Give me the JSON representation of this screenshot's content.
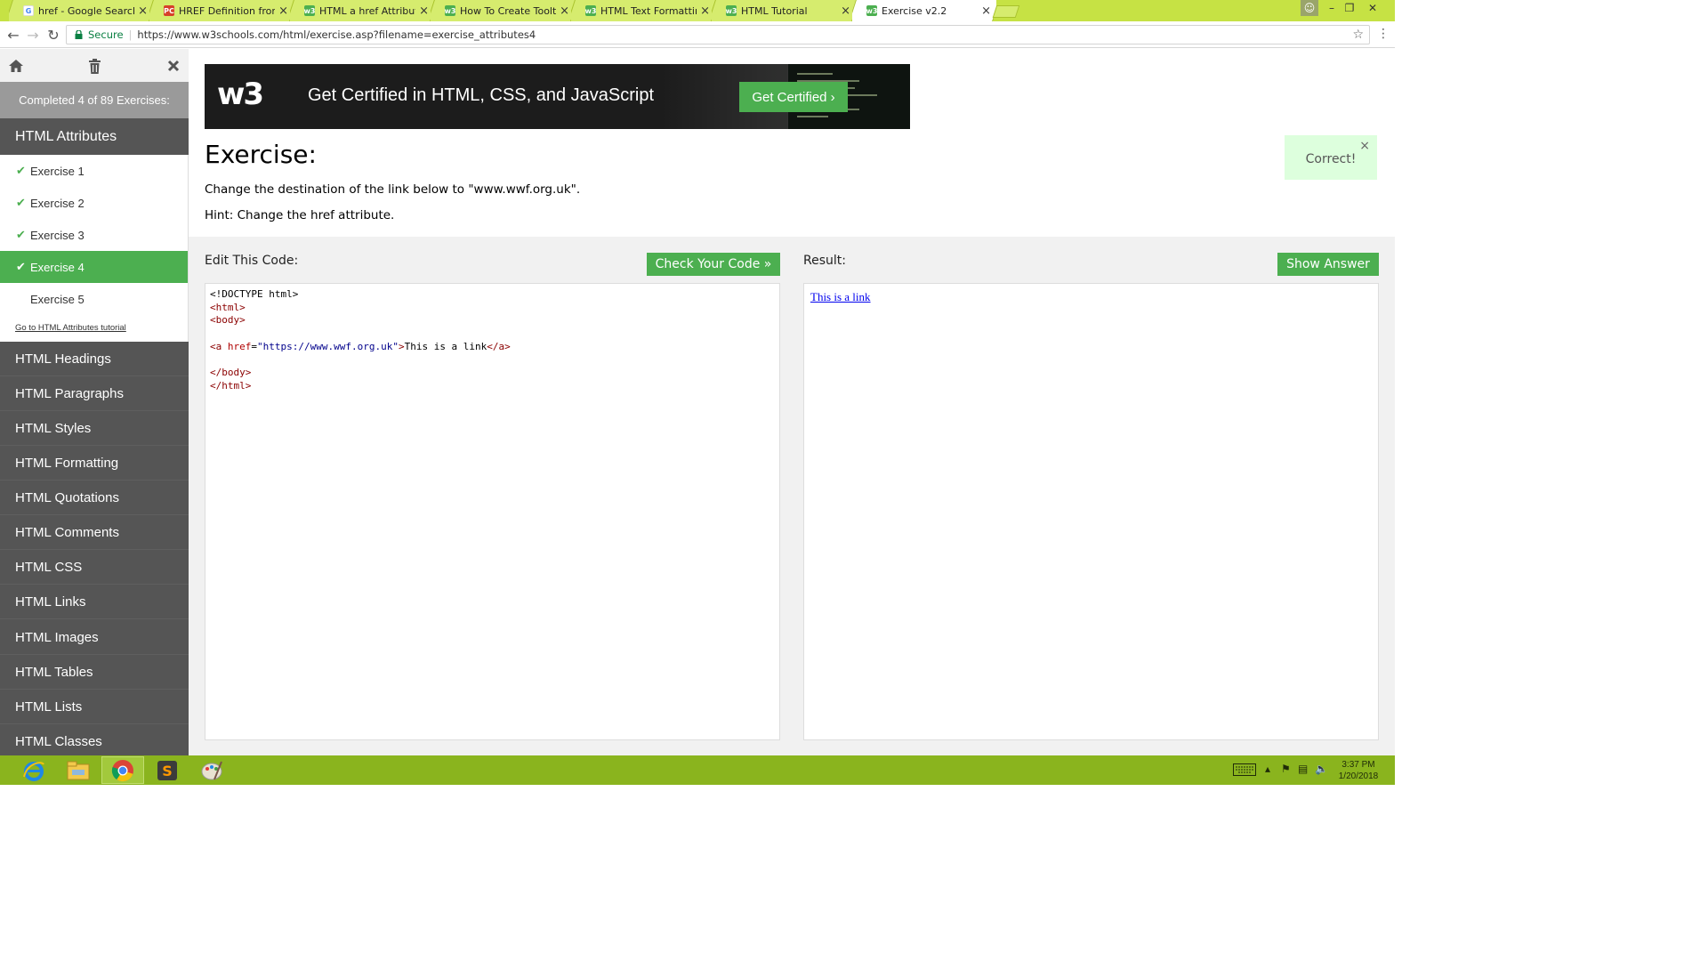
{
  "browser": {
    "tabs": [
      {
        "title": "href - Google Search",
        "favicon": "google-icon"
      },
      {
        "title": "HREF Definition from PC",
        "favicon": "pcmag-icon"
      },
      {
        "title": "HTML a href Attribute",
        "favicon": "w3schools-icon"
      },
      {
        "title": "How To Create Tooltips",
        "favicon": "w3schools-icon"
      },
      {
        "title": "HTML Text Formatting",
        "favicon": "w3schools-icon"
      },
      {
        "title": "HTML Tutorial",
        "favicon": "w3schools-icon"
      },
      {
        "title": "Exercise v2.2",
        "favicon": "w3schools-icon",
        "active": true
      }
    ],
    "secure_label": "Secure",
    "url": "https://www.w3schools.com/html/exercise.asp?filename=exercise_attributes4",
    "accent_color": "#c6e244"
  },
  "sidebar": {
    "completed": "Completed 4 of 89 Exercises:",
    "active_category": "HTML Attributes",
    "exercises": [
      {
        "label": "Exercise 1",
        "done": true
      },
      {
        "label": "Exercise 2",
        "done": true
      },
      {
        "label": "Exercise 3",
        "done": true
      },
      {
        "label": "Exercise 4",
        "done": true,
        "active": true
      },
      {
        "label": "Exercise 5",
        "done": false
      }
    ],
    "tutorial_link": "Go to HTML Attributes tutorial",
    "categories": [
      "HTML Headings",
      "HTML Paragraphs",
      "HTML Styles",
      "HTML Formatting",
      "HTML Quotations",
      "HTML Comments",
      "HTML CSS",
      "HTML Links",
      "HTML Images",
      "HTML Tables",
      "HTML Lists",
      "HTML Classes"
    ]
  },
  "banner": {
    "logo": "w3",
    "text": "Get Certified in HTML, CSS, and JavaScript",
    "button": "Get Certified ›"
  },
  "exercise": {
    "title": "Exercise:",
    "description": "Change the destination of the link below to \"www.wwf.org.uk\".",
    "hint": "Hint: Change the href attribute.",
    "correct_label": "Correct!",
    "close_symbol": "×"
  },
  "editor": {
    "heading": "Edit This Code:",
    "check_button": "Check Your Code »",
    "code": {
      "doctype": "<!DOCTYPE html>",
      "html_open": "<html>",
      "body_open": "<body>",
      "a_open": "<a ",
      "attr_name": "href",
      "attr_eq": "=",
      "attr_value": "\"https://www.wwf.org.uk\"",
      "a_close_bracket": ">",
      "link_text": "This is a link",
      "a_close": "</a>",
      "body_close": "</body>",
      "html_close": "</html>"
    }
  },
  "result": {
    "heading": "Result:",
    "show_answer_button": "Show Answer",
    "link_text": "This is a link"
  },
  "taskbar": {
    "apps": [
      "internet-explorer-icon",
      "file-explorer-icon",
      "chrome-icon",
      "sublime-text-icon",
      "paint-icon"
    ],
    "time": "3:37 PM",
    "date": "1/20/2018"
  }
}
